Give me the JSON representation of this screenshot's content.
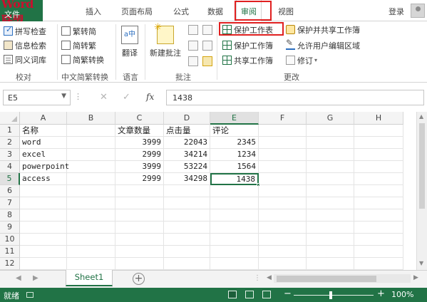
{
  "app": {
    "watermark": "Word联盟",
    "file_tab": "文件"
  },
  "tabs": [
    "插入",
    "页面布局",
    "公式",
    "数据",
    "审阅",
    "视图"
  ],
  "active_tab": "审阅",
  "account": {
    "login": "登录"
  },
  "ribbon": {
    "proofing": {
      "items": [
        "拼写检查",
        "信息检索",
        "同义词库"
      ],
      "label": "校对"
    },
    "chinese": {
      "items": [
        "繁转简",
        "简转繁",
        "简繁转换"
      ],
      "label": "中文简繁转换"
    },
    "language": {
      "button": "翻译",
      "label": "语言"
    },
    "comments": {
      "button": "新建批注",
      "label": "批注"
    },
    "changes": {
      "col1": [
        "保护工作表",
        "保护工作簿",
        "共享工作簿"
      ],
      "col2": [
        "保护并共享工作簿",
        "允许用户编辑区域",
        "修订"
      ],
      "label": "更改"
    }
  },
  "formula_bar": {
    "name_box": "E5",
    "fx": "fx",
    "value": "1438"
  },
  "grid": {
    "columns": [
      "A",
      "B",
      "C",
      "D",
      "E",
      "F",
      "G",
      "H"
    ],
    "selected_column": "E",
    "rows": [
      "1",
      "2",
      "3",
      "4",
      "5",
      "6",
      "7",
      "8",
      "9",
      "10",
      "11",
      "12"
    ],
    "selected_row": "5",
    "data": [
      [
        "名称",
        "",
        "文章数量",
        "点击量",
        "评论"
      ],
      [
        "word",
        "",
        "3999",
        "22043",
        "2345"
      ],
      [
        "excel",
        "",
        "2999",
        "34214",
        "1234"
      ],
      [
        "powerpoint",
        "",
        "3999",
        "53224",
        "1564"
      ],
      [
        "access",
        "",
        "2999",
        "34298",
        "1438"
      ]
    ],
    "active_cell": "E5"
  },
  "sheets": {
    "tabs": [
      "Sheet1"
    ],
    "active": "Sheet1"
  },
  "status": {
    "ready": "就绪",
    "zoom": "100%"
  },
  "colors": {
    "accent": "#217346",
    "highlight": "#e02020"
  }
}
